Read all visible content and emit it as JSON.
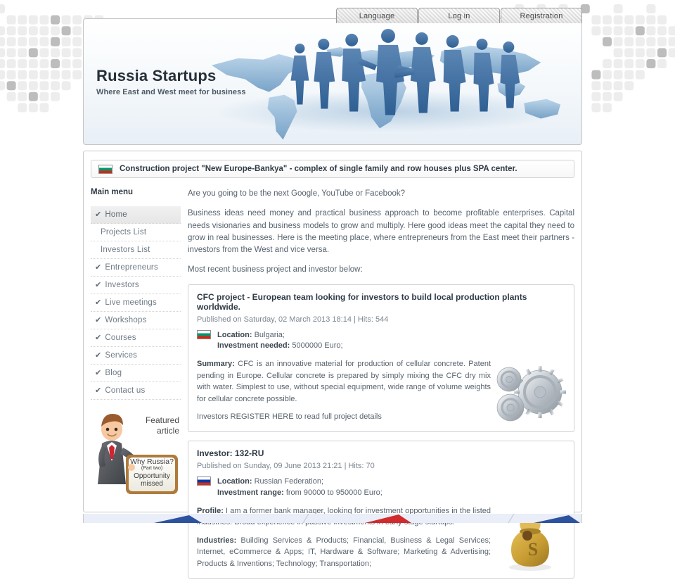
{
  "tabs": [
    {
      "label": "Language",
      "active": true
    },
    {
      "label": "Log in",
      "active": false
    },
    {
      "label": "Registration",
      "active": false
    }
  ],
  "header": {
    "title": "Russia Startups",
    "tagline": "Where East and West meet for business",
    "art_name": "world-map-business-people-illustration"
  },
  "announcement": {
    "flag": "bulgaria-flag-icon",
    "text": "Construction project \"New Europe-Bankya\" - complex of single family and row houses plus SPA center."
  },
  "sidebar": {
    "title": "Main menu",
    "items": [
      {
        "label": "Home",
        "check": true,
        "sub": false,
        "active": true
      },
      {
        "label": "Projects List",
        "check": false,
        "sub": true,
        "active": false
      },
      {
        "label": "Investors List",
        "check": false,
        "sub": true,
        "active": false
      },
      {
        "label": "Entrepreneurs",
        "check": true,
        "sub": false,
        "active": false
      },
      {
        "label": "Investors",
        "check": true,
        "sub": false,
        "active": false
      },
      {
        "label": "Live meetings",
        "check": true,
        "sub": false,
        "active": false
      },
      {
        "label": "Workshops",
        "check": true,
        "sub": false,
        "active": false
      },
      {
        "label": "Courses",
        "check": true,
        "sub": false,
        "active": false
      },
      {
        "label": "Services",
        "check": true,
        "sub": false,
        "active": false
      },
      {
        "label": "Blog",
        "check": true,
        "sub": false,
        "active": false
      },
      {
        "label": "Contact us",
        "check": true,
        "sub": false,
        "active": false
      }
    ],
    "featured": {
      "kicker_line1": "Featured",
      "kicker_line2": "article",
      "sign_line1": "Why Russia?",
      "sign_line2": "(Part two)",
      "sign_line3": "Opportunity",
      "sign_line4": "missed",
      "art_name": "businessman-holding-sign-illustration"
    }
  },
  "main": {
    "intro_question": "Are you going to be the next Google, YouTube or Facebook?",
    "intro_paragraph": "Business ideas need money and practical business approach to become profitable enterprises. Capital needs visionaries and business models to grow and multiply. Here good ideas meet the capital they need to grow in real businesses. Here is the meeting place, where entrepreneurs from the East meet their partners - investors from the West and vice versa.",
    "intro_note": "Most recent business project and investor below:",
    "cards": [
      {
        "title": "CFC project - European team looking for investors to build local production plants worldwide.",
        "meta": "Published on Saturday, 02 March 2013 18:14 | Hits: 544",
        "flag": "bulgaria-flag-icon",
        "line1_label": "Location:",
        "line1_value": "Bulgaria;",
        "line2_label": "Investment needed:",
        "line2_value": "5000000 Euro;",
        "body_label": "Summary:",
        "body_text": "CFC is an innovative material for production of cellular concrete. Patent pending in Europe. Cellular concrete is prepared by simply mixing the CFC dry mix with water. Simplest to use, without special equipment, wide range of volume weights for cellular concrete possible.",
        "footer_text": "Investors REGISTER HERE to read full project details",
        "art_name": "metal-gears-image"
      },
      {
        "title": "Investor: 132-RU",
        "meta": "Published on Sunday, 09 June 2013 21:21 | Hits: 70",
        "flag": "russia-flag-icon",
        "line1_label": "Location:",
        "line1_value": "Russian Federation;",
        "line2_label": "Investment range:",
        "line2_value": "from 90000 to 950000 Euro;",
        "body_label": "Profile:",
        "body_text": "I am a former bank manager, looking for investment opportunities in the listed industries. Broad experience in passive investments in early stage startups.",
        "industries_label": "Industries:",
        "industries_text": "Building Services & Products; Financial, Business & Legal Services; Internet, eCommerce & Apps; IT, Hardware & Software; Marketing & Advertising; Products & Inventions; Technology; Transportation;",
        "art_name": "money-bag-image"
      }
    ]
  },
  "colors": {
    "accent_blue": "#3a63a8",
    "accent_red": "#d52b1e",
    "text_dark": "#2f3a45",
    "text_body": "#58636e",
    "panel_border": "#c9c9c9"
  }
}
